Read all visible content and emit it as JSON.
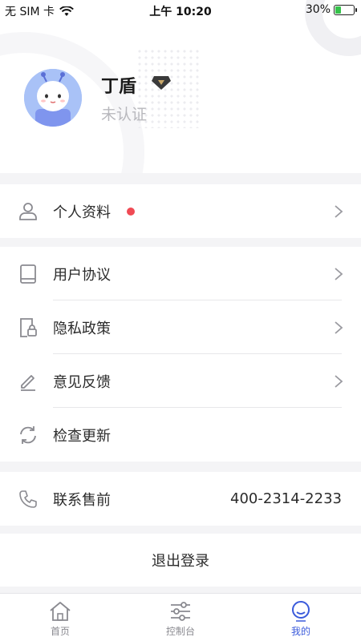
{
  "status_bar": {
    "carrier": "无 SIM 卡",
    "time": "上午 10:20",
    "battery": "30%",
    "battery_level": 0.3
  },
  "profile": {
    "name": "丁盾",
    "verification": "未认证",
    "badge_icon": "rank-diamond-icon"
  },
  "menu_groups": [
    {
      "items": [
        {
          "label": "个人资料",
          "icon": "user-icon",
          "has_dot": true
        }
      ]
    },
    {
      "items": [
        {
          "label": "用户协议",
          "icon": "book-icon"
        },
        {
          "label": "隐私政策",
          "icon": "lock-document-icon"
        },
        {
          "label": "意见反馈",
          "icon": "pencil-icon"
        },
        {
          "label": "检查更新",
          "icon": "refresh-icon"
        }
      ]
    },
    {
      "items": [
        {
          "label": "联系售前",
          "icon": "phone-icon",
          "value": "400-2314-2233"
        }
      ]
    }
  ],
  "logout_label": "退出登录",
  "tabbar": {
    "tabs": [
      {
        "label": "首页",
        "icon": "home-icon",
        "active": false
      },
      {
        "label": "控制台",
        "icon": "sliders-icon",
        "active": false
      },
      {
        "label": "我的",
        "icon": "profile-icon",
        "active": true
      }
    ]
  },
  "colors": {
    "accent": "#3b5bdb",
    "notification_dot": "#f04a54",
    "background": "#f4f4f6"
  }
}
